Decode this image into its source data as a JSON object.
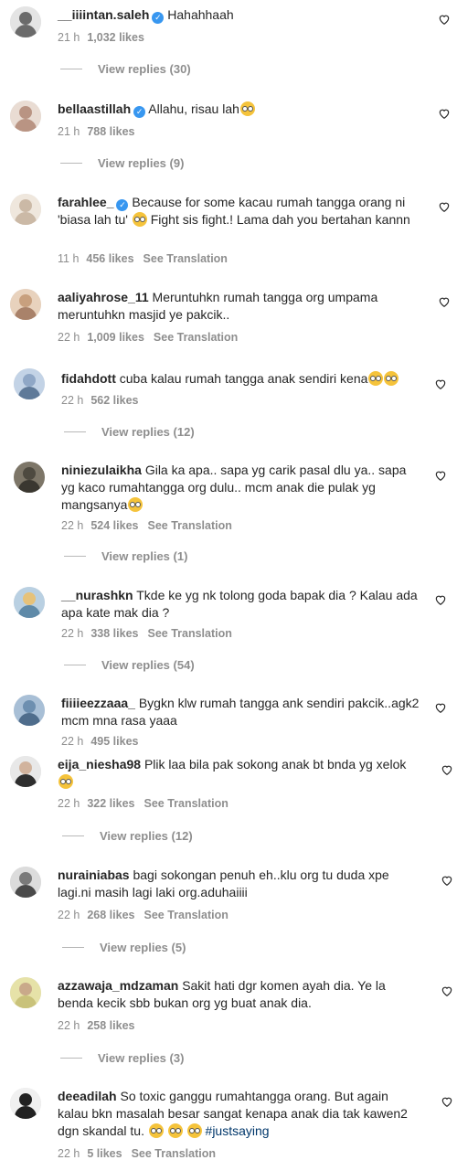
{
  "comments": [
    {
      "username": "__iiiintan.saleh",
      "verified": true,
      "text": "Hahahhaah",
      "time": "21 h",
      "likes": "1,032 likes",
      "translate": "",
      "replies": "View replies (30)",
      "avatar_color": "#6b6b6b"
    },
    {
      "username": "bellaastillah",
      "verified": true,
      "text": "Allahu, risau lah",
      "time": "21 h",
      "likes": "788 likes",
      "translate": "",
      "replies": "View replies (9)",
      "avatar_color": "#b99483"
    },
    {
      "username": "farahlee_",
      "verified": true,
      "text": "Because for some kacau rumah tangga orang ni 'biasa lah tu'",
      "text2": "Fight sis fight.! Lama dah you bertahan kannn",
      "time": "11 h",
      "likes": "456 likes",
      "translate": "See Translation",
      "replies": "",
      "avatar_color": "#e3d7c8"
    },
    {
      "username": "aaliyahrose_11",
      "verified": false,
      "text": "Meruntuhkn rumah tangga org umpama meruntuhkn masjid ye pakcik..",
      "time": "22 h",
      "likes": "1,009 likes",
      "translate": "See Translation",
      "replies": "",
      "avatar_color": "#c8a07e"
    },
    {
      "username": "fidahdott",
      "verified": false,
      "text": "cuba kalau rumah tangga anak sendiri kena",
      "time": "22 h",
      "likes": "562 likes",
      "translate": "",
      "replies": "View replies (12)",
      "avatar_color": "#8fa7c6"
    },
    {
      "username": "niniezulaikha",
      "verified": false,
      "text": "Gila ka apa.. sapa yg carik pasal dlu ya.. sapa yg kaco rumahtangga org dulu.. mcm anak die pulak yg mangsanya",
      "time": "22 h",
      "likes": "524 likes",
      "translate": "See Translation",
      "replies": "View replies (1)",
      "avatar_color": "#4e4a40"
    },
    {
      "username": "__nurashkn",
      "verified": false,
      "text": "Tkde ke yg nk tolong goda bapak dia ? Kalau ada apa kate mak dia ?",
      "time": "22 h",
      "likes": "338 likes",
      "translate": "See Translation",
      "replies": "View replies (54)",
      "avatar_color": "#5f8aa8"
    },
    {
      "username": "fiiiieezzaaa_",
      "verified": false,
      "text": "Bygkn klw rumah tangga ank sendiri pakcik..agk2 mcm mna rasa yaaa",
      "time": "22 h",
      "likes": "495 likes",
      "translate": "",
      "replies": "",
      "avatar_color": "#6d8fb0"
    },
    {
      "username": "eija_niesha98",
      "verified": false,
      "text": "Plik laa bila pak sokong anak bt bnda yg xelok",
      "time": "22 h",
      "likes": "322 likes",
      "translate": "See Translation",
      "replies": "View replies (12)",
      "avatar_color": "#2e2e2e"
    },
    {
      "username": "nurainiabas",
      "verified": false,
      "text": "bagi sokongan penuh eh..klu org tu duda xpe lagi.ni masih lagi laki org.aduhaiiii",
      "time": "22 h",
      "likes": "268 likes",
      "translate": "See Translation",
      "replies": "View replies (5)",
      "avatar_color": "#7a7a7a"
    },
    {
      "username": "azzawaja_mdzaman",
      "verified": false,
      "text": "Sakit hati dgr komen ayah dia. Ye la benda kecik sbb bukan org yg buat anak dia.",
      "time": "22 h",
      "likes": "258 likes",
      "translate": "",
      "replies": "View replies (3)",
      "avatar_color": "#c9c27a"
    },
    {
      "username": "deeadilah",
      "verified": false,
      "text": "So toxic ganggu rumahtangga orang. But again kalau bkn masalah besar sangat kenapa anak dia tak kawen2 dgn skandal tu.",
      "hashtag": "#justsaying",
      "time": "22 h",
      "likes": "5 likes",
      "translate": "See Translation",
      "replies": "",
      "avatar_color": "#cfcfcf"
    }
  ],
  "icons": {
    "like": "heart-outline-icon",
    "verified": "verified-badge-icon"
  }
}
